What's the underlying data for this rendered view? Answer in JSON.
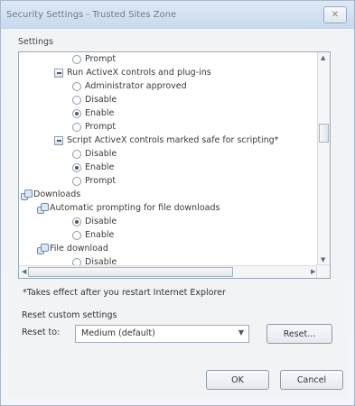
{
  "window": {
    "title": "Security Settings - Trusted Sites Zone",
    "close_glyph": "✕"
  },
  "settings": {
    "label": "Settings",
    "items": [
      {
        "kind": "radio",
        "label": "Prompt",
        "checked": false
      },
      {
        "kind": "checkbox-folder",
        "label": "Run ActiveX controls and plug-ins"
      },
      {
        "kind": "radio",
        "label": "Administrator approved",
        "checked": false
      },
      {
        "kind": "radio",
        "label": "Disable",
        "checked": false
      },
      {
        "kind": "radio",
        "label": "Enable",
        "checked": true
      },
      {
        "kind": "radio",
        "label": "Prompt",
        "checked": false
      },
      {
        "kind": "checkbox-folder",
        "label": "Script ActiveX controls marked safe for scripting*"
      },
      {
        "kind": "radio",
        "label": "Disable",
        "checked": false
      },
      {
        "kind": "radio",
        "label": "Enable",
        "checked": true
      },
      {
        "kind": "radio",
        "label": "Prompt",
        "checked": false
      },
      {
        "kind": "category",
        "label": "Downloads"
      },
      {
        "kind": "subcategory",
        "label": "Automatic prompting for file downloads"
      },
      {
        "kind": "radio",
        "label": "Disable",
        "checked": true
      },
      {
        "kind": "radio",
        "label": "Enable",
        "checked": false
      },
      {
        "kind": "subcategory",
        "label": "File download"
      },
      {
        "kind": "radio",
        "label": "Disable",
        "checked": false
      }
    ]
  },
  "note": "*Takes effect after you restart Internet Explorer",
  "reset": {
    "section_label": "Reset custom settings",
    "reset_to_label": "Reset to:",
    "selected": "Medium (default)",
    "button": "Reset..."
  },
  "buttons": {
    "ok": "OK",
    "cancel": "Cancel"
  },
  "icons": {
    "folder": "folder-icon",
    "gear": "settings-icon",
    "radio": "radio-icon"
  }
}
